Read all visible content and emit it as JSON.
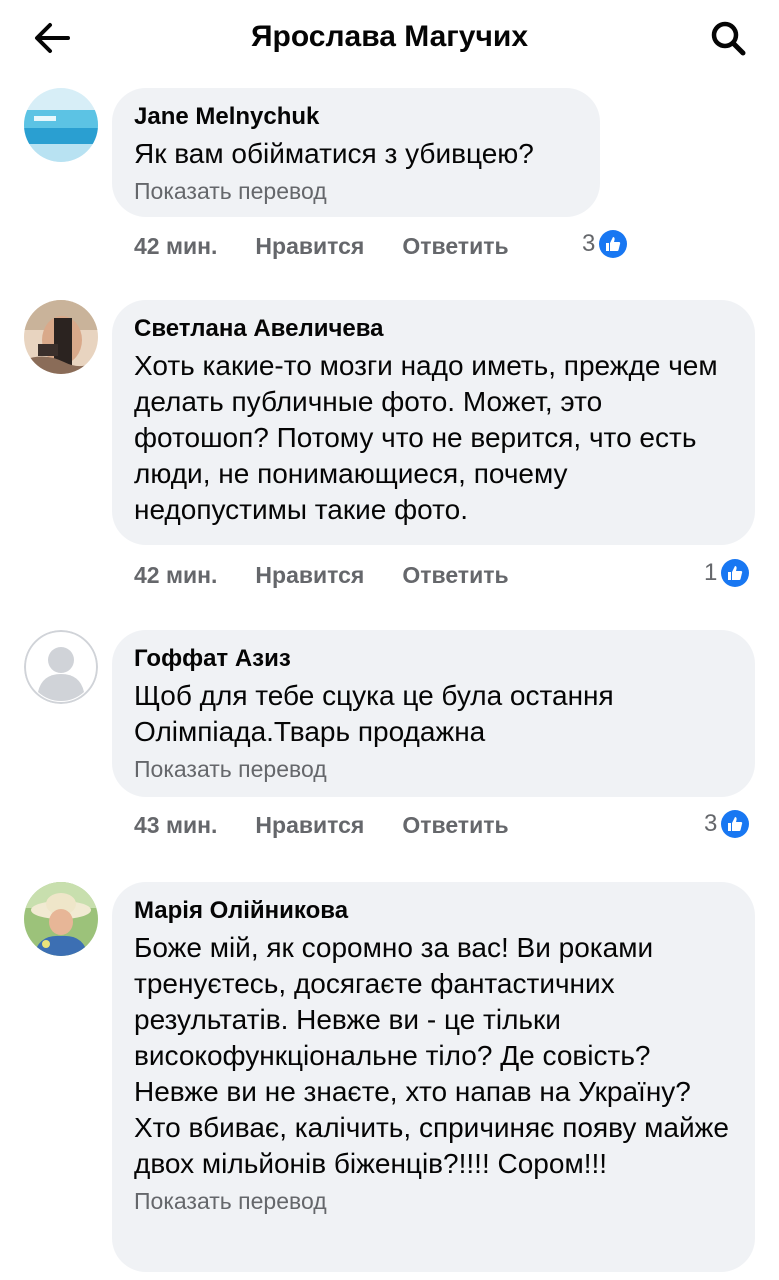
{
  "header": {
    "title": "Ярослава Магучих",
    "back_icon": "arrow-left-icon",
    "search_icon": "search-icon"
  },
  "actions_labels": {
    "like": "Нравится",
    "reply": "Ответить"
  },
  "translate_label": "Показать перевод",
  "colors": {
    "bubble": "#f0f2f5",
    "secondary_text": "#65676b",
    "like_blue": "#1877f2"
  },
  "comments": [
    {
      "author": "Jane Melnychuk",
      "text": "Як вам обійматися з убивцею?",
      "show_translate": true,
      "time": "42 мин.",
      "reactions": "3",
      "avatar": "pool-photo-avatar"
    },
    {
      "author": "Светлана Авеличева",
      "text": "Хоть какие-то мозги надо иметь, прежде чем делать публичные фото. Может, это фотошоп? Потому что не верится, что есть люди, не понимающиеся, почему недопустимы такие фото.",
      "show_translate": false,
      "time": "42 мин.",
      "reactions": "1",
      "avatar": "woman-photo-avatar"
    },
    {
      "author": "Гоффат Азиз",
      "text": "Щоб для тебе сцука це була остання Олімпіада.Тварь продажна",
      "show_translate": true,
      "time": "43 мин.",
      "reactions": "3",
      "avatar": "default-user-avatar"
    },
    {
      "author": "Марія Олійникова",
      "text": "Боже мій, як соромно за вас! Ви роками тренуєтесь, досягаєте фантастичних результатів. Невже ви - це тільки високофункціональне тіло? Де совість? Невже ви не знаєте, хто напав на Україну? Хто вбиває, калічить, спричиняє появу майже двох мільйонів біженців?!!!! Сором!!!",
      "show_translate": true,
      "avatar": "woman-hat-photo-avatar"
    }
  ]
}
